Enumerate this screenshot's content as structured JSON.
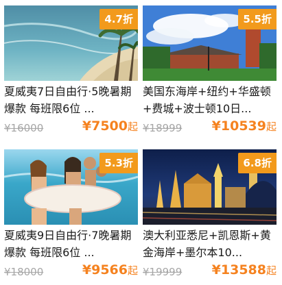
{
  "cards": [
    {
      "badge": "4.7折",
      "title": "夏威夷7日自由行·5晚暑期爆款 每班限6位 ...",
      "old_price": "¥16000",
      "new_price": "¥7500",
      "price_suffix": "起"
    },
    {
      "badge": "5.5折",
      "title": "美国东海岸+纽约+华盛顿+费城+波士顿10日...",
      "old_price": "¥18999",
      "new_price": "¥10539",
      "price_suffix": "起"
    },
    {
      "badge": "5.3折",
      "title": "夏威夷9日自由行·7晚暑期爆款 每班限6位 ...",
      "old_price": "¥18000",
      "new_price": "¥9566",
      "price_suffix": "起"
    },
    {
      "badge": "6.8折",
      "title": "澳大利亚悉尼+凯恩斯+黄金海岸+墨尔本10...",
      "old_price": "¥19999",
      "new_price": "¥13588",
      "price_suffix": "起"
    }
  ],
  "colors": {
    "badge": "#f29a1c",
    "price": "#f5821f",
    "old_price": "#a6a6a6"
  }
}
